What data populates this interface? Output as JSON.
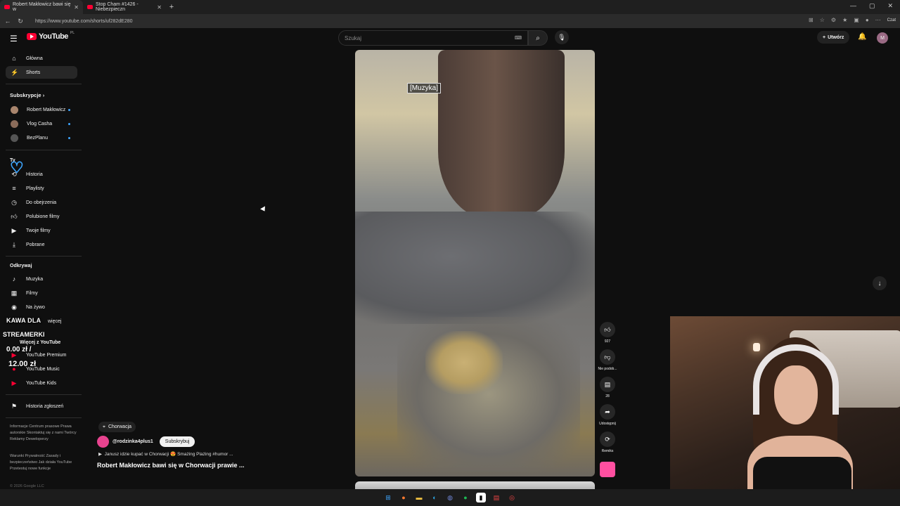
{
  "browser": {
    "tabs": [
      {
        "title": "Robert Makłowicz bawi się w"
      },
      {
        "title": "Stop Cham #1426 - Niebezpieczn"
      }
    ],
    "url": "https://www.youtube.com/shorts/uf282dE280",
    "window_controls": [
      "—",
      "▢",
      "✕"
    ],
    "chat_label": "Czat"
  },
  "header": {
    "logo_text": "YouTube",
    "logo_country": "PL",
    "search_placeholder": "Szukaj",
    "create_label": "Utwórz",
    "avatar_letter": "M"
  },
  "sidebar": {
    "main": [
      {
        "label": "Główna",
        "icon": "home-icon"
      },
      {
        "label": "Shorts",
        "icon": "shorts-icon"
      }
    ],
    "subs_title": "Subskrypcje",
    "subs": [
      {
        "label": "Robert Makłowicz"
      },
      {
        "label": "Vlog Casha"
      },
      {
        "label": "BezPlanu"
      }
    ],
    "you_title": "Ty",
    "you": [
      {
        "label": "Historia",
        "icon": "history-icon"
      },
      {
        "label": "Playlisty",
        "icon": "playlist-icon"
      },
      {
        "label": "Do obejrzenia",
        "icon": "watch-later-icon"
      },
      {
        "label": "Polubione filmy",
        "icon": "like-icon"
      },
      {
        "label": "Twoje filmy",
        "icon": "your-videos-icon"
      },
      {
        "label": "Pobrane",
        "icon": "download-icon"
      }
    ],
    "explore_title": "Odkrywaj",
    "explore": [
      {
        "label": "Muzyka",
        "icon": "music-icon"
      },
      {
        "label": "Filmy",
        "icon": "movies-icon"
      },
      {
        "label": "Na żywo",
        "icon": "live-icon"
      },
      {
        "label": "więcej",
        "icon": "more-icon"
      }
    ],
    "more_title": "Więcej z YouTube",
    "more": [
      {
        "label": "YouTube Premium"
      },
      {
        "label": "YouTube Music"
      },
      {
        "label": "YouTube Kids"
      }
    ],
    "report_history": "Historia zgłoszeń",
    "footer1": "Informacje Centrum prasowe Prawa autorskie Skontaktuj się z nami Twórcy Reklamy Deweloperzy",
    "footer2": "Warunki Prywatność Zasady i bezpieczeństwo Jak działa YouTube Przetestuj nowe funkcje",
    "copyright": "© 2026 Google LLC"
  },
  "video": {
    "caption": "[Muzyka]",
    "location": "Chorwacja",
    "channel": "@rodzinka4plus1",
    "subscribe_label": "Subskrybuj",
    "music_line": "Janusz idzie kupać w Chorwacji 😍 Smażing Plażing #humor ...",
    "title": "Robert Makłowicz bawi się w Chorwacji prawie ..."
  },
  "actions": {
    "likes": "927",
    "dislike_label": "Nie podob...",
    "comments": "28",
    "share_label": "Udostępnij",
    "remix_label": "Remiks"
  },
  "overlay": {
    "kawa": "KAWA DLA",
    "streamerki": "STREAMERKI",
    "amount1": "0.00 zł /",
    "amount2": "12.00 zł"
  },
  "colors": {
    "accent": "#ff0033",
    "link": "#3ea6ff",
    "bg": "#0f0f0f"
  }
}
